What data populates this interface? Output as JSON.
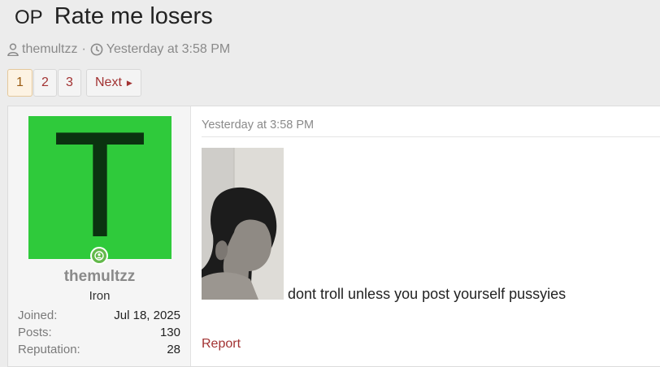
{
  "thread": {
    "prefix": "OP",
    "title": "Rate me losers",
    "author": "themultzz",
    "separator": "·",
    "date": "Yesterday at 3:58 PM"
  },
  "pager": {
    "pages": [
      "1",
      "2",
      "3"
    ],
    "current": "1",
    "next_label": "Next"
  },
  "post": {
    "avatar_letter": "T",
    "avatar_color": "#2fca3b",
    "username": "themultzz",
    "rank": "Iron",
    "stats": [
      {
        "label": "Joined:",
        "value": "Jul 18, 2025"
      },
      {
        "label": "Posts:",
        "value": "130"
      },
      {
        "label": "Reputation:",
        "value": "28"
      }
    ],
    "date": "Yesterday at 3:58 PM",
    "message": "dont troll unless you post yourself pussyies",
    "report_label": "Report"
  },
  "icons": {
    "user": "user-icon",
    "clock": "clock-icon",
    "online": "online-status-icon",
    "next": "caret-right-icon"
  }
}
